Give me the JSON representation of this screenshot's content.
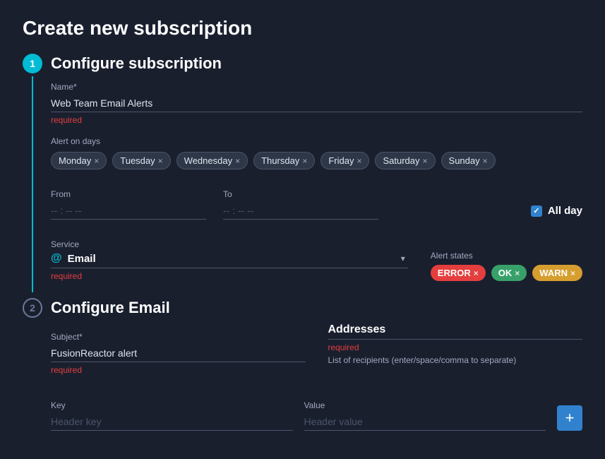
{
  "page": {
    "title": "Create new subscription"
  },
  "section1": {
    "badge": "1",
    "title": "Configure subscription",
    "name_label": "Name*",
    "name_value": "Web Team Email Alerts",
    "name_error": "required",
    "days_label": "Alert on days",
    "days": [
      "Monday",
      "Tuesday",
      "Wednesday",
      "Thursday",
      "Friday",
      "Saturday",
      "Sunday"
    ],
    "from_label": "From",
    "from_placeholder": "-- : -- --",
    "to_label": "To",
    "to_placeholder": "-- : -- --",
    "all_day_label": "All day",
    "service_label": "Service",
    "service_icon": "@",
    "service_value": "Email",
    "service_error": "required",
    "alert_states_label": "Alert states",
    "alert_states": [
      {
        "label": "ERROR",
        "type": "error"
      },
      {
        "label": "OK",
        "type": "ok"
      },
      {
        "label": "WARN",
        "type": "warn"
      }
    ]
  },
  "section2": {
    "badge": "2",
    "title": "Configure Email",
    "subject_label": "Subject*",
    "subject_value": "FusionReactor alert",
    "subject_error": "required",
    "addresses_label": "Addresses",
    "addresses_error": "required",
    "addresses_hint": "List of recipients (enter/space/comma to separate)",
    "key_label": "Key",
    "key_placeholder": "Header key",
    "value_label": "Value",
    "value_placeholder": "Header value",
    "add_button_label": "+"
  }
}
